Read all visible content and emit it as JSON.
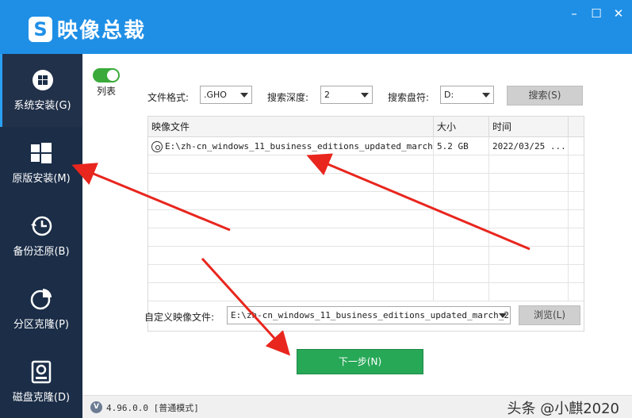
{
  "app": {
    "logo_letter": "S",
    "title": "映像总裁"
  },
  "window": {
    "min": "–",
    "max": "☐",
    "close": "✕"
  },
  "sidebar": {
    "items": [
      {
        "label": "系统安装(G)",
        "icon": "windows-logo-icon"
      },
      {
        "label": "原版安装(M)",
        "icon": "windows-tiles-icon"
      },
      {
        "label": "备份还原(B)",
        "icon": "clock-backup-icon"
      },
      {
        "label": "分区克隆(P)",
        "icon": "pie-partition-icon"
      },
      {
        "label": "磁盘克隆(D)",
        "icon": "disk-clone-icon"
      }
    ]
  },
  "main": {
    "toggle_label": "列表",
    "file_format": {
      "label": "文件格式:",
      "value": ".GHO"
    },
    "search_depth": {
      "label": "搜索深度:",
      "value": "2"
    },
    "search_drive": {
      "label": "搜索盘符:",
      "value": "D:"
    },
    "search_button": "搜索(S)",
    "table": {
      "headers": [
        "映像文件",
        "大小",
        "时间"
      ],
      "rows": [
        {
          "file": "E:\\zh-cn_windows_11_business_editions_updated_march...",
          "size": "5.2 GB",
          "time": "2022/03/25 ..."
        }
      ]
    },
    "custom_image": {
      "label": "自定义映像文件:",
      "value": "E:\\zh-cn_windows_11_business_editions_updated_march_2"
    },
    "browse_button": "浏览(L)",
    "next_button": "下一步(N)"
  },
  "status": {
    "version": "4.96.0.0 [普通模式]",
    "version_icon": "V",
    "watermark": "头条 @小麒2020"
  },
  "colors": {
    "titlebar": "#1f8fe6",
    "sidebar": "#1b2d47",
    "accent_green": "#27a857",
    "annotation_arrow": "#e8261e"
  }
}
